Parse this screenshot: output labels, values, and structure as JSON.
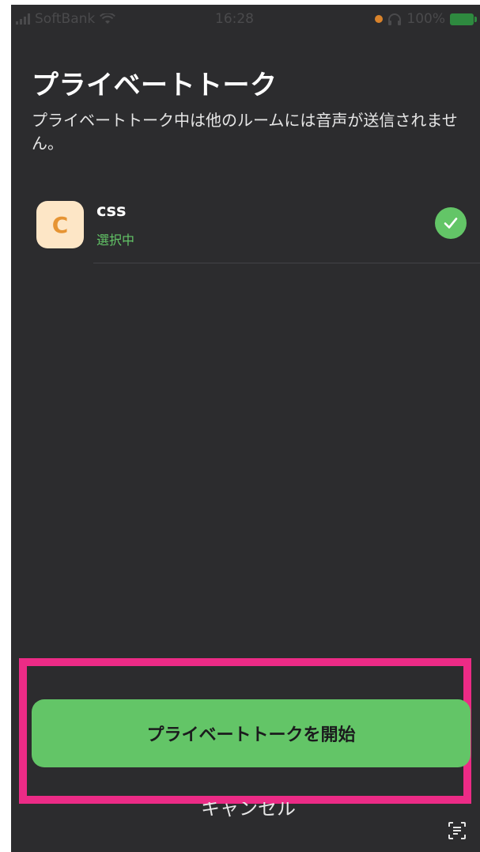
{
  "status_bar": {
    "carrier": "SoftBank",
    "time": "16:28",
    "battery": "100%",
    "icons": [
      "signal-icon",
      "wifi-icon",
      "recording-dot-icon",
      "headphone-icon",
      "battery-icon"
    ]
  },
  "header": {
    "title": "プライベートトーク",
    "description": "プライベートトーク中は他のルームには音声が送信されません。"
  },
  "rooms": [
    {
      "avatar_letter": "C",
      "name": "css",
      "status": "選択中",
      "selected": true,
      "icon": "check-icon"
    }
  ],
  "actions": {
    "start_label": "プライベートトークを開始",
    "cancel_label": "キャンセル"
  },
  "colors": {
    "background": "#2c2c2e",
    "accent_green": "#63c567",
    "avatar_bg": "#fde6c6",
    "avatar_text": "#e69433",
    "highlight": "#ec2b86"
  }
}
